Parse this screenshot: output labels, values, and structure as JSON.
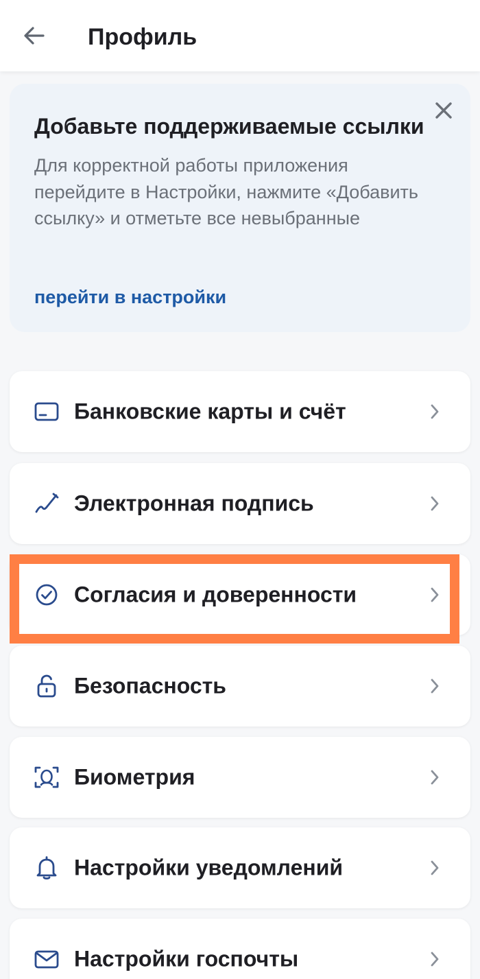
{
  "header": {
    "title": "Профиль",
    "back_icon": "arrow-left-icon"
  },
  "banner": {
    "title": "Добавьте поддерживаемые ссылки",
    "text": "Для корректной работы приложения перейдите в Настройки, нажмите «Добавить ссылку» и отметьте все невыбранные",
    "link": "перейти в настройки",
    "close_icon": "close-icon"
  },
  "menu": {
    "items": [
      {
        "label": "Банковские карты и счёт",
        "icon": "card-icon"
      },
      {
        "label": "Электронная подпись",
        "icon": "signature-pen-icon"
      },
      {
        "label": "Согласия и доверенности",
        "icon": "check-circle-icon"
      },
      {
        "label": "Безопасность",
        "icon": "lock-icon"
      },
      {
        "label": "Биометрия",
        "icon": "face-scan-icon"
      },
      {
        "label": "Настройки уведомлений",
        "icon": "bell-icon"
      },
      {
        "label": "Настройки госпочты",
        "icon": "envelope-icon"
      }
    ]
  },
  "colors": {
    "accent": "#1e5aa6",
    "icon": "#2a4b8d",
    "highlight": "#ff7f44",
    "banner_bg": "#eef3f9"
  }
}
